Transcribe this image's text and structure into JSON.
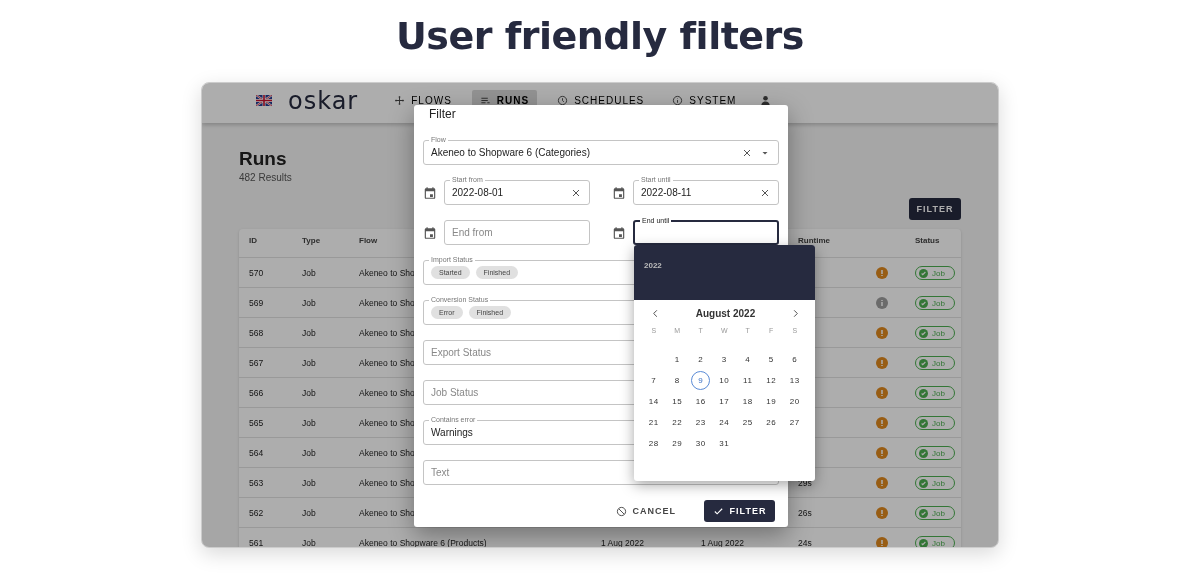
{
  "heading": "User friendly filters",
  "nav": {
    "logo": "oskar",
    "items": [
      {
        "label": "FLOWS",
        "selected": false
      },
      {
        "label": "RUNS",
        "selected": true
      },
      {
        "label": "SCHEDULES",
        "selected": false
      },
      {
        "label": "SYSTEM",
        "selected": false
      }
    ]
  },
  "page": {
    "title": "Runs",
    "count": "482 Results",
    "filter_button": "FILTER"
  },
  "table": {
    "columns": [
      "ID",
      "Type",
      "Flow",
      "Runtime",
      "Status"
    ],
    "rows": [
      {
        "id": "570",
        "type": "Job",
        "flow": "Akeneo to Sho",
        "kind": "warning",
        "status": "Job"
      },
      {
        "id": "569",
        "type": "Job",
        "flow": "Akeneo to Sho",
        "kind": "info",
        "status": "Job"
      },
      {
        "id": "568",
        "type": "Job",
        "flow": "Akeneo to Sho",
        "kind": "warning",
        "status": "Job"
      },
      {
        "id": "567",
        "type": "Job",
        "flow": "Akeneo to Sho",
        "kind": "warning",
        "status": "Job"
      },
      {
        "id": "566",
        "type": "Job",
        "flow": "Akeneo to Sho",
        "kind": "warning",
        "status": "Job"
      },
      {
        "id": "565",
        "type": "Job",
        "flow": "Akeneo to Sho",
        "kind": "warning",
        "status": "Job"
      },
      {
        "id": "564",
        "type": "Job",
        "flow": "Akeneo to Sho",
        "kind": "warning",
        "status": "Job"
      },
      {
        "id": "563",
        "type": "Job",
        "flow": "Akeneo to Sho",
        "runtime": "29s",
        "kind": "warning",
        "status": "Job"
      },
      {
        "id": "562",
        "type": "Job",
        "flow": "Akeneo to Sho",
        "runtime": "26s",
        "kind": "warning",
        "status": "Job"
      },
      {
        "id": "561",
        "type": "Job",
        "flow": "Akeneo to Shopware 6 (Products)",
        "column_4": "1 Aug 2022",
        "column_5": "1 Aug 2022",
        "runtime": "24s",
        "kind": "warning",
        "status": "Job"
      }
    ]
  },
  "dialog": {
    "title": "Filter",
    "flow": {
      "label": "Flow",
      "value": "Akeneo to Shopware 6 (Categories)"
    },
    "date_rows": [
      {
        "from": {
          "label": "Start from",
          "value": "2022-08-01",
          "focused": false
        },
        "until": {
          "label": "Start until",
          "value": "2022-08-11",
          "focused": false
        }
      },
      {
        "from": {
          "placeholder": "End from",
          "focused": false
        },
        "until": {
          "label": "End until",
          "focused": true
        }
      }
    ],
    "fields": [
      {
        "kind": "chips",
        "label": "Import Status",
        "chips": [
          "Started",
          "Finished"
        ]
      },
      {
        "kind": "chips",
        "label": "Conversion Status",
        "chips": [
          "Error",
          "Finished"
        ]
      },
      {
        "kind": "empty",
        "placeholder": "Export Status"
      },
      {
        "kind": "empty",
        "placeholder": "Job Status"
      },
      {
        "kind": "value",
        "label": "Contains error",
        "value": "Warnings"
      },
      {
        "kind": "empty",
        "placeholder": "Text"
      }
    ],
    "cancel": "CANCEL",
    "submit": "FILTER"
  },
  "calendar": {
    "year": "2022",
    "month": "August 2022",
    "weekdays": [
      "S",
      "M",
      "T",
      "W",
      "T",
      "F",
      "S"
    ],
    "days": [
      {
        "label": "1",
        "today": false
      },
      {
        "label": "2",
        "today": false
      },
      {
        "label": "3",
        "today": false
      },
      {
        "label": "4",
        "today": false
      },
      {
        "label": "5",
        "today": false
      },
      {
        "label": "6",
        "today": false
      },
      {
        "label": "7",
        "today": false
      },
      {
        "label": "8",
        "today": false
      },
      {
        "label": "9",
        "today": true
      },
      {
        "label": "10",
        "today": false
      },
      {
        "label": "11",
        "today": false
      },
      {
        "label": "12",
        "today": false
      },
      {
        "label": "13",
        "today": false
      },
      {
        "label": "14",
        "today": false
      },
      {
        "label": "15",
        "today": false
      },
      {
        "label": "16",
        "today": false
      },
      {
        "label": "17",
        "today": false
      },
      {
        "label": "18",
        "today": false
      },
      {
        "label": "19",
        "today": false
      },
      {
        "label": "20",
        "today": false
      },
      {
        "label": "21",
        "today": false
      },
      {
        "label": "22",
        "today": false
      },
      {
        "label": "23",
        "today": false
      },
      {
        "label": "24",
        "today": false
      },
      {
        "label": "25",
        "today": false
      },
      {
        "label": "26",
        "today": false
      },
      {
        "label": "27",
        "today": false
      },
      {
        "label": "28",
        "today": false
      },
      {
        "label": "29",
        "today": false
      },
      {
        "label": "30",
        "today": false
      },
      {
        "label": "31",
        "today": false
      }
    ]
  }
}
